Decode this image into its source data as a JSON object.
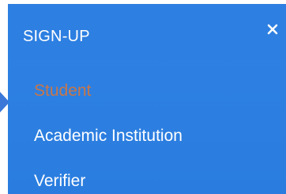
{
  "panel": {
    "title": "SIGN-UP",
    "close_icon": "close-icon",
    "accent_color": "#2b7de0",
    "active_color": "#c7764a"
  },
  "menu": {
    "items": [
      {
        "label": "Student",
        "active": true
      },
      {
        "label": "Academic Institution",
        "active": false
      },
      {
        "label": "Verifier",
        "active": false
      }
    ]
  }
}
